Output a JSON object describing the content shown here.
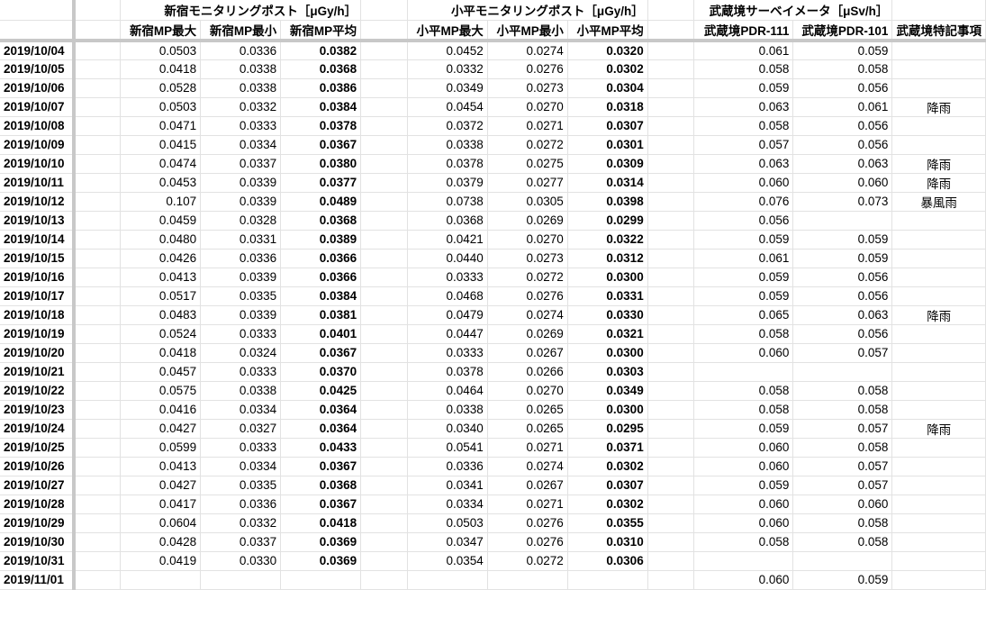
{
  "header": {
    "group_shinjuku": "新宿モニタリングポスト［μGy/h］",
    "group_kodaira": "小平モニタリングポスト［μGy/h］",
    "group_musashisakai": "武蔵境サーベイメータ［μSv/h］",
    "columns": [
      "新宿MP最大",
      "新宿MP最小",
      "新宿MP平均",
      "小平MP最大",
      "小平MP最小",
      "小平MP平均",
      "武蔵境PDR-111",
      "武蔵境PDR-101",
      "武蔵境特記事項"
    ]
  },
  "rows": [
    {
      "date": "2019/10/04",
      "s_max": "0.0503",
      "s_min": "0.0336",
      "s_avg": "0.0382",
      "k_max": "0.0452",
      "k_min": "0.0274",
      "k_avg": "0.0320",
      "p111": "0.061",
      "p101": "0.059",
      "note": ""
    },
    {
      "date": "2019/10/05",
      "s_max": "0.0418",
      "s_min": "0.0338",
      "s_avg": "0.0368",
      "k_max": "0.0332",
      "k_min": "0.0276",
      "k_avg": "0.0302",
      "p111": "0.058",
      "p101": "0.058",
      "note": ""
    },
    {
      "date": "2019/10/06",
      "s_max": "0.0528",
      "s_min": "0.0338",
      "s_avg": "0.0386",
      "k_max": "0.0349",
      "k_min": "0.0273",
      "k_avg": "0.0304",
      "p111": "0.059",
      "p101": "0.056",
      "note": ""
    },
    {
      "date": "2019/10/07",
      "s_max": "0.0503",
      "s_min": "0.0332",
      "s_avg": "0.0384",
      "k_max": "0.0454",
      "k_min": "0.0270",
      "k_avg": "0.0318",
      "p111": "0.063",
      "p101": "0.061",
      "note": "降雨"
    },
    {
      "date": "2019/10/08",
      "s_max": "0.0471",
      "s_min": "0.0333",
      "s_avg": "0.0378",
      "k_max": "0.0372",
      "k_min": "0.0271",
      "k_avg": "0.0307",
      "p111": "0.058",
      "p101": "0.056",
      "note": ""
    },
    {
      "date": "2019/10/09",
      "s_max": "0.0415",
      "s_min": "0.0334",
      "s_avg": "0.0367",
      "k_max": "0.0338",
      "k_min": "0.0272",
      "k_avg": "0.0301",
      "p111": "0.057",
      "p101": "0.056",
      "note": ""
    },
    {
      "date": "2019/10/10",
      "s_max": "0.0474",
      "s_min": "0.0337",
      "s_avg": "0.0380",
      "k_max": "0.0378",
      "k_min": "0.0275",
      "k_avg": "0.0309",
      "p111": "0.063",
      "p101": "0.063",
      "note": "降雨"
    },
    {
      "date": "2019/10/11",
      "s_max": "0.0453",
      "s_min": "0.0339",
      "s_avg": "0.0377",
      "k_max": "0.0379",
      "k_min": "0.0277",
      "k_avg": "0.0314",
      "p111": "0.060",
      "p101": "0.060",
      "note": "降雨"
    },
    {
      "date": "2019/10/12",
      "s_max": "0.107",
      "s_min": "0.0339",
      "s_avg": "0.0489",
      "k_max": "0.0738",
      "k_min": "0.0305",
      "k_avg": "0.0398",
      "p111": "0.076",
      "p101": "0.073",
      "note": "暴風雨"
    },
    {
      "date": "2019/10/13",
      "s_max": "0.0459",
      "s_min": "0.0328",
      "s_avg": "0.0368",
      "k_max": "0.0368",
      "k_min": "0.0269",
      "k_avg": "0.0299",
      "p111": "0.056",
      "p101": "",
      "note": ""
    },
    {
      "date": "2019/10/14",
      "s_max": "0.0480",
      "s_min": "0.0331",
      "s_avg": "0.0389",
      "k_max": "0.0421",
      "k_min": "0.0270",
      "k_avg": "0.0322",
      "p111": "0.059",
      "p101": "0.059",
      "note": ""
    },
    {
      "date": "2019/10/15",
      "s_max": "0.0426",
      "s_min": "0.0336",
      "s_avg": "0.0366",
      "k_max": "0.0440",
      "k_min": "0.0273",
      "k_avg": "0.0312",
      "p111": "0.061",
      "p101": "0.059",
      "note": ""
    },
    {
      "date": "2019/10/16",
      "s_max": "0.0413",
      "s_min": "0.0339",
      "s_avg": "0.0366",
      "k_max": "0.0333",
      "k_min": "0.0272",
      "k_avg": "0.0300",
      "p111": "0.059",
      "p101": "0.056",
      "note": ""
    },
    {
      "date": "2019/10/17",
      "s_max": "0.0517",
      "s_min": "0.0335",
      "s_avg": "0.0384",
      "k_max": "0.0468",
      "k_min": "0.0276",
      "k_avg": "0.0331",
      "p111": "0.059",
      "p101": "0.056",
      "note": ""
    },
    {
      "date": "2019/10/18",
      "s_max": "0.0483",
      "s_min": "0.0339",
      "s_avg": "0.0381",
      "k_max": "0.0479",
      "k_min": "0.0274",
      "k_avg": "0.0330",
      "p111": "0.065",
      "p101": "0.063",
      "note": "降雨"
    },
    {
      "date": "2019/10/19",
      "s_max": "0.0524",
      "s_min": "0.0333",
      "s_avg": "0.0401",
      "k_max": "0.0447",
      "k_min": "0.0269",
      "k_avg": "0.0321",
      "p111": "0.058",
      "p101": "0.056",
      "note": ""
    },
    {
      "date": "2019/10/20",
      "s_max": "0.0418",
      "s_min": "0.0324",
      "s_avg": "0.0367",
      "k_max": "0.0333",
      "k_min": "0.0267",
      "k_avg": "0.0300",
      "p111": "0.060",
      "p101": "0.057",
      "note": ""
    },
    {
      "date": "2019/10/21",
      "s_max": "0.0457",
      "s_min": "0.0333",
      "s_avg": "0.0370",
      "k_max": "0.0378",
      "k_min": "0.0266",
      "k_avg": "0.0303",
      "p111": "",
      "p101": "",
      "note": ""
    },
    {
      "date": "2019/10/22",
      "s_max": "0.0575",
      "s_min": "0.0338",
      "s_avg": "0.0425",
      "k_max": "0.0464",
      "k_min": "0.0270",
      "k_avg": "0.0349",
      "p111": "0.058",
      "p101": "0.058",
      "note": ""
    },
    {
      "date": "2019/10/23",
      "s_max": "0.0416",
      "s_min": "0.0334",
      "s_avg": "0.0364",
      "k_max": "0.0338",
      "k_min": "0.0265",
      "k_avg": "0.0300",
      "p111": "0.058",
      "p101": "0.058",
      "note": ""
    },
    {
      "date": "2019/10/24",
      "s_max": "0.0427",
      "s_min": "0.0327",
      "s_avg": "0.0364",
      "k_max": "0.0340",
      "k_min": "0.0265",
      "k_avg": "0.0295",
      "p111": "0.059",
      "p101": "0.057",
      "note": "降雨"
    },
    {
      "date": "2019/10/25",
      "s_max": "0.0599",
      "s_min": "0.0333",
      "s_avg": "0.0433",
      "k_max": "0.0541",
      "k_min": "0.0271",
      "k_avg": "0.0371",
      "p111": "0.060",
      "p101": "0.058",
      "note": ""
    },
    {
      "date": "2019/10/26",
      "s_max": "0.0413",
      "s_min": "0.0334",
      "s_avg": "0.0367",
      "k_max": "0.0336",
      "k_min": "0.0274",
      "k_avg": "0.0302",
      "p111": "0.060",
      "p101": "0.057",
      "note": ""
    },
    {
      "date": "2019/10/27",
      "s_max": "0.0427",
      "s_min": "0.0335",
      "s_avg": "0.0368",
      "k_max": "0.0341",
      "k_min": "0.0267",
      "k_avg": "0.0307",
      "p111": "0.059",
      "p101": "0.057",
      "note": ""
    },
    {
      "date": "2019/10/28",
      "s_max": "0.0417",
      "s_min": "0.0336",
      "s_avg": "0.0367",
      "k_max": "0.0334",
      "k_min": "0.0271",
      "k_avg": "0.0302",
      "p111": "0.060",
      "p101": "0.060",
      "note": ""
    },
    {
      "date": "2019/10/29",
      "s_max": "0.0604",
      "s_min": "0.0332",
      "s_avg": "0.0418",
      "k_max": "0.0503",
      "k_min": "0.0276",
      "k_avg": "0.0355",
      "p111": "0.060",
      "p101": "0.058",
      "note": ""
    },
    {
      "date": "2019/10/30",
      "s_max": "0.0428",
      "s_min": "0.0337",
      "s_avg": "0.0369",
      "k_max": "0.0347",
      "k_min": "0.0276",
      "k_avg": "0.0310",
      "p111": "0.058",
      "p101": "0.058",
      "note": ""
    },
    {
      "date": "2019/10/31",
      "s_max": "0.0419",
      "s_min": "0.0330",
      "s_avg": "0.0369",
      "k_max": "0.0354",
      "k_min": "0.0272",
      "k_avg": "0.0306",
      "p111": "",
      "p101": "",
      "note": ""
    },
    {
      "date": "2019/11/01",
      "s_max": "",
      "s_min": "",
      "s_avg": "",
      "k_max": "",
      "k_min": "",
      "k_avg": "",
      "p111": "0.060",
      "p101": "0.059",
      "note": ""
    }
  ]
}
